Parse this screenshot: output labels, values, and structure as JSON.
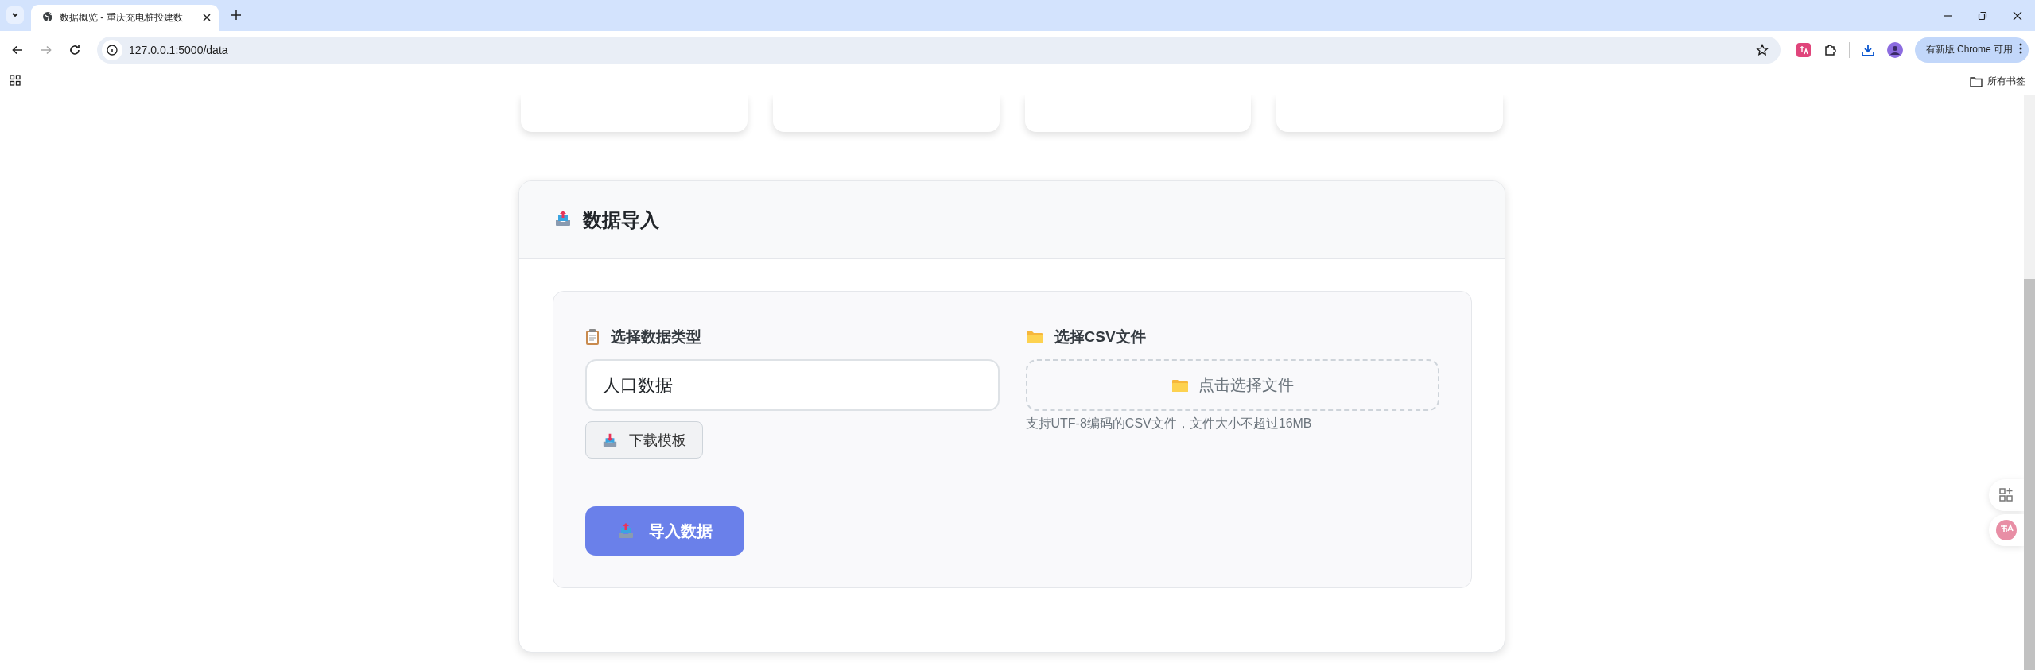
{
  "browser": {
    "tabs": [
      {
        "title": "数据概览 - 重庆充电桩投建数",
        "selected": true
      }
    ],
    "nav_buttons": [
      {
        "kind": "back",
        "disabled": false
      },
      {
        "kind": "forward",
        "disabled": true
      },
      {
        "kind": "reload",
        "disabled": false
      }
    ],
    "address": "127.0.0.1:5000/data",
    "update_button": "有新版 Chrome 可用",
    "bookmarks_folder": "所有书签"
  },
  "import_panel": {
    "title": "数据导入",
    "type_label": "选择数据类型",
    "type_value": "人口数据",
    "template_button": "下载模板",
    "file_label": "选择CSV文件",
    "file_prompt": "点击选择文件",
    "file_hint": "支持UTF-8编码的CSV文件，文件大小不超过16MB",
    "submit_button": "导入数据"
  }
}
